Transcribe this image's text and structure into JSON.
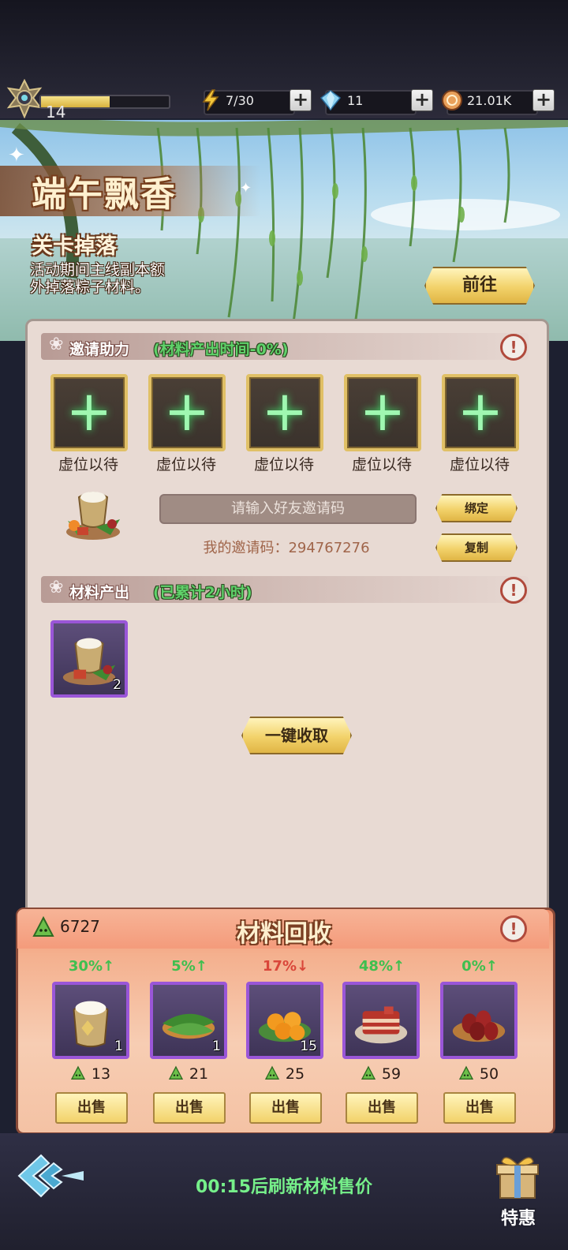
{
  "player": {
    "level": "14",
    "xp_fraction": 0.54
  },
  "resources": [
    {
      "icon": "lightning-icon",
      "value": "7/30"
    },
    {
      "icon": "diamond-icon",
      "value": "11"
    },
    {
      "icon": "coin-icon",
      "value": "21.01K"
    }
  ],
  "plus_label": "+",
  "event": {
    "title": "端午飘香",
    "drop_title": "关卡掉落",
    "drop_desc_line1": "活动期间主线副本额",
    "drop_desc_line2": "外掉落粽子材料。",
    "goto_label": "前往"
  },
  "invite": {
    "section_label": "邀请助力",
    "section_note": "(材料产出时间-0%)",
    "info_label": "!",
    "slot_plus": "+",
    "slots": [
      "虚位以待",
      "虚位以待",
      "虚位以待",
      "虚位以待",
      "虚位以待"
    ],
    "input_placeholder": "请输入好友邀请码",
    "my_code": "我的邀请码：294767276",
    "bind_label": "绑定",
    "copy_label": "复制"
  },
  "production": {
    "section_label": "材料产出",
    "section_note": "(已累计2小时)",
    "info_label": "!",
    "item_count": "2",
    "collect_label": "一键收取"
  },
  "recycle": {
    "title": "材料回收",
    "currency": "6727",
    "info_label": "!",
    "sell_label": "出售",
    "items": [
      {
        "name": "rice-sack-icon",
        "pct": "30%↑",
        "trend": "up",
        "count": "1",
        "price": "13"
      },
      {
        "name": "bamboo-leaves-icon",
        "pct": "5%↑",
        "trend": "up",
        "count": "1",
        "price": "21"
      },
      {
        "name": "egg-yolk-icon",
        "pct": "17%↓",
        "trend": "down",
        "count": "15",
        "price": "25"
      },
      {
        "name": "pork-belly-icon",
        "pct": "48%↑",
        "trend": "up",
        "count": "",
        "price": "59"
      },
      {
        "name": "jujube-icon",
        "pct": "0%↑",
        "trend": "up",
        "count": "",
        "price": "50"
      }
    ]
  },
  "footer": {
    "refresh_text": "00:15后刷新材料售价",
    "tehui_label": "特惠"
  },
  "colors": {
    "up": "#3fbf4f",
    "down": "#d9463a"
  }
}
